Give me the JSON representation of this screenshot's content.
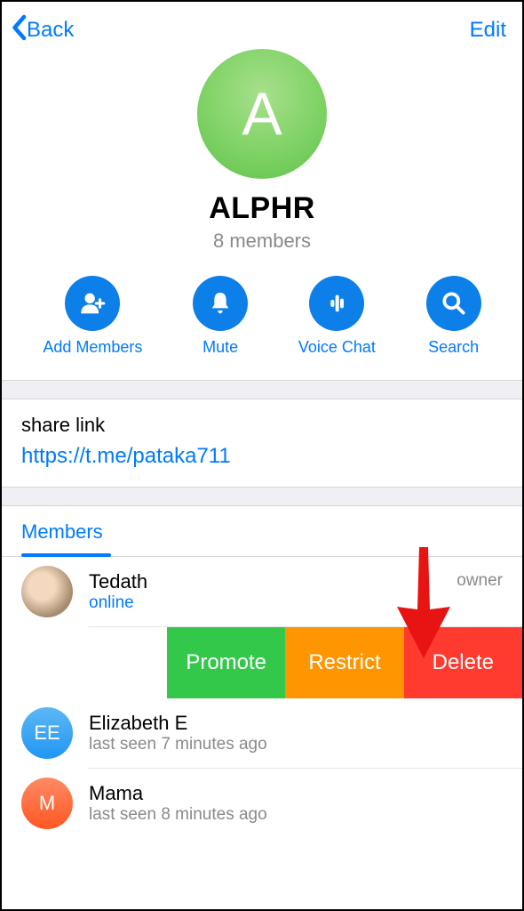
{
  "header": {
    "back_label": "Back",
    "edit_label": "Edit"
  },
  "group": {
    "initial": "A",
    "name": "ALPHR",
    "subtitle": "8 members"
  },
  "actions": {
    "add": "Add Members",
    "mute": "Mute",
    "voice": "Voice Chat",
    "search": "Search"
  },
  "share": {
    "label": "share link",
    "url": "https://t.me/pataka711"
  },
  "tabs": {
    "members": "Members"
  },
  "members": [
    {
      "name": "Tedath",
      "status": "online",
      "tag": "owner",
      "avatar_text": ""
    },
    {
      "name": "Elizabeth E",
      "status": "last seen 7 minutes ago",
      "avatar_text": "EE"
    },
    {
      "name": "Mama",
      "status": "last seen 8 minutes ago",
      "avatar_text": "M"
    }
  ],
  "swipe": {
    "promote": "Promote",
    "restrict": "Restrict",
    "delete": "Delete"
  }
}
